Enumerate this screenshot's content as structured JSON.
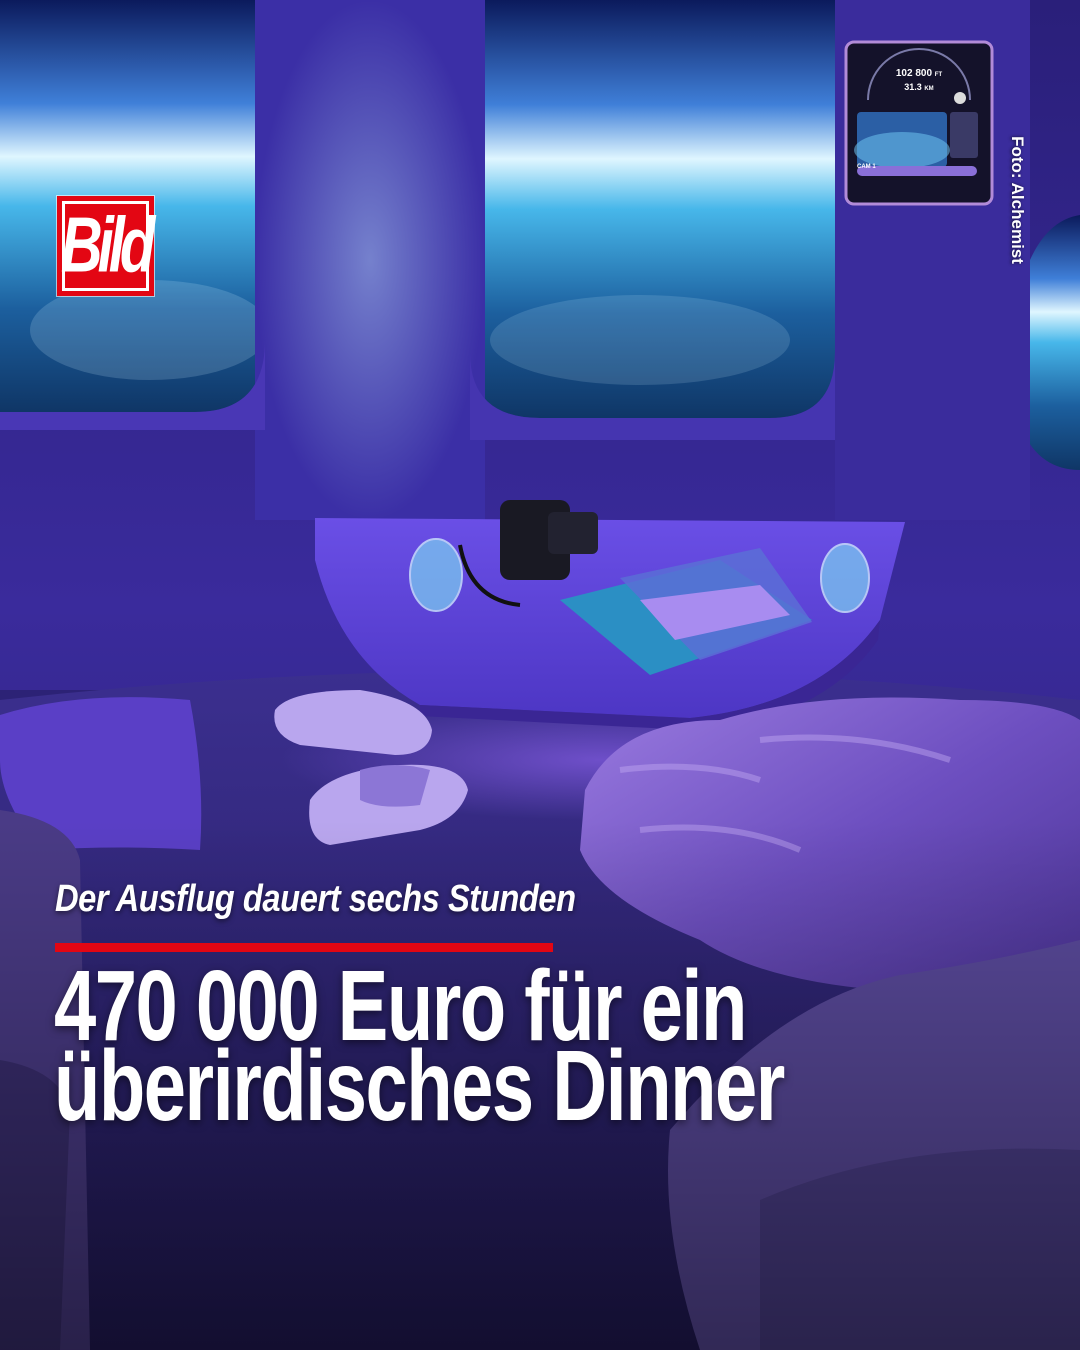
{
  "brand": {
    "logo_text": "Bild",
    "color": "#e30613"
  },
  "credit": "Foto: Alchemist",
  "tablet": {
    "altitude": "102 800",
    "altitude_unit": "FT",
    "speed": "31.3",
    "speed_unit": "KM",
    "camera": "CAM 1"
  },
  "caption": {
    "kicker": "Der Ausflug dauert sechs Stunden",
    "headline_line1": "470 000 Euro für ein",
    "headline_line2": "überirdisches Dinner"
  },
  "colors": {
    "accent": "#e30613",
    "interior": "#3b2c9a",
    "earth": "#3fb2e6"
  }
}
